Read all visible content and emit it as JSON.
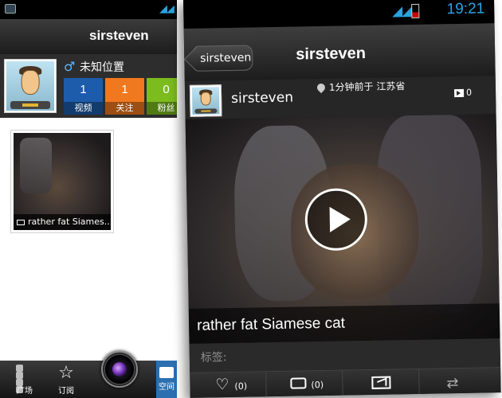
{
  "left": {
    "title": "sirsteven",
    "gender_symbol": "♂",
    "location": "未知位置",
    "stats": [
      {
        "value": "1",
        "label": "视频",
        "color": "#1d5caa"
      },
      {
        "value": "1",
        "label": "关注",
        "color": "#f0781e"
      },
      {
        "value": "0",
        "label": "粉丝",
        "color": "#7cbc1e"
      }
    ],
    "thumb_caption": "rather fat Siames...",
    "nav": [
      {
        "label": "广场",
        "icon": "grid-icon"
      },
      {
        "label": "订阅",
        "icon": "star-icon"
      },
      {
        "label": "",
        "icon": "camera-icon"
      },
      {
        "label": "空间",
        "icon": "profile-card-icon"
      }
    ],
    "status_icon": "notification-icon",
    "star_glyph": "☆",
    "signal_glyph": "◢◢"
  },
  "right": {
    "status": {
      "time": "19:21",
      "signal_glyph": "◢◢"
    },
    "back_label": "sirsteven",
    "title": "sirsteven",
    "username": "sirsteven",
    "post_meta": "1分钟前于 江苏省",
    "view_count": "0",
    "video_caption": "rather fat Siamese cat",
    "tags_label": "标签:",
    "actions": [
      {
        "icon": "heart-icon",
        "glyph": "♡",
        "count": "(0)"
      },
      {
        "icon": "comment-icon",
        "count": "(0)"
      },
      {
        "icon": "share-video-icon"
      },
      {
        "icon": "repost-arrows-icon",
        "glyph": "⇄"
      }
    ],
    "accent": "#2aa4e0"
  }
}
